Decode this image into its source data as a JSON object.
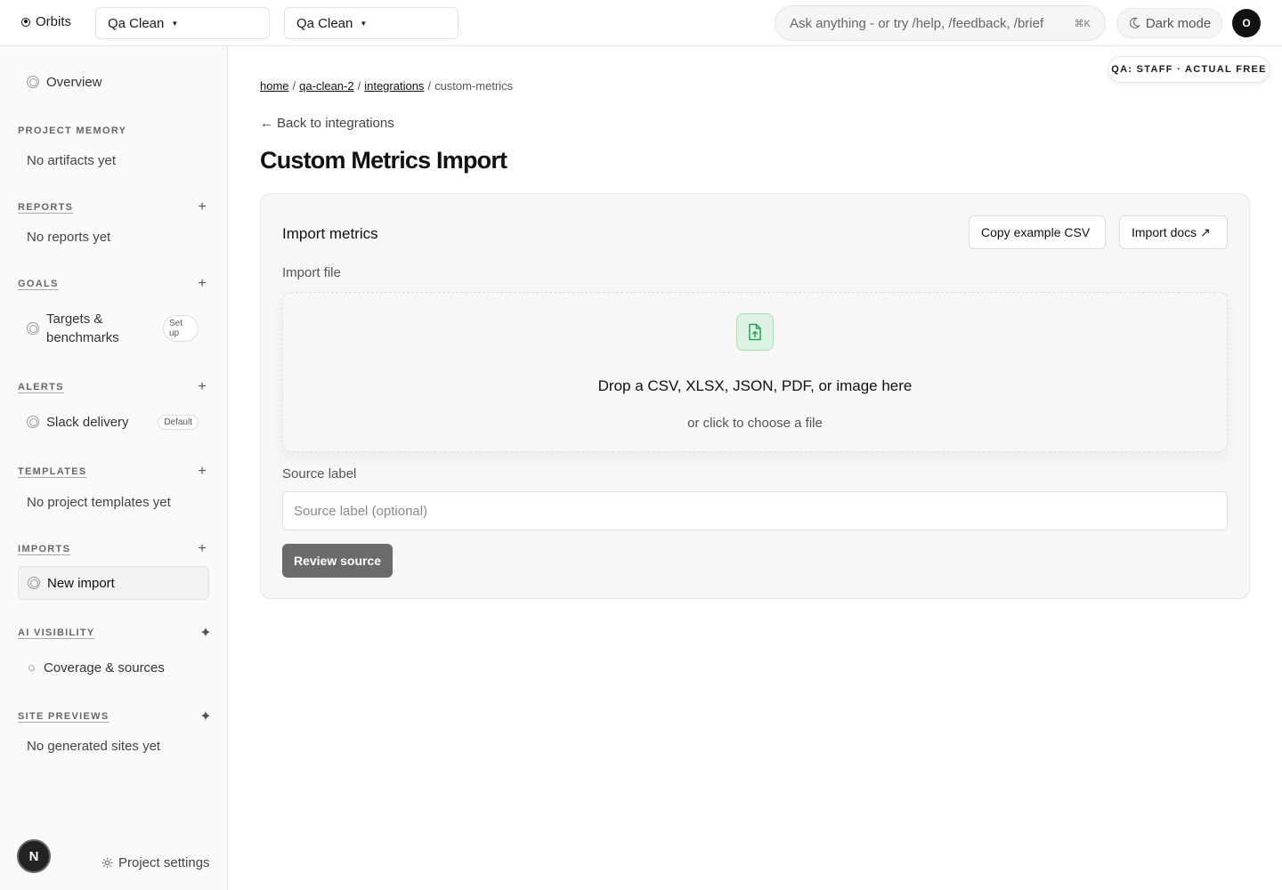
{
  "topbar": {
    "brand": "Orbits",
    "workspace_select": "Qa Clean",
    "project_select": "Qa Clean",
    "command_placeholder": "Ask anything - or try /help, /feedback, /brief",
    "command_shortcut": "⌘K",
    "dark_mode_label": "Dark mode",
    "avatar_initial": "O"
  },
  "sidebar": {
    "overview": "Overview",
    "sections": {
      "project_memory": {
        "label": "PROJECT MEMORY",
        "empty": "No artifacts yet"
      },
      "reports": {
        "label": "REPORTS",
        "empty": "No reports yet"
      },
      "goals": {
        "label": "GOALS",
        "item": "Targets & benchmarks",
        "badge": "Set up"
      },
      "alerts": {
        "label": "ALERTS",
        "item": "Slack delivery",
        "badge": "Default"
      },
      "templates": {
        "label": "TEMPLATES",
        "empty": "No project templates yet"
      },
      "imports": {
        "label": "IMPORTS",
        "item": "New import"
      },
      "ai_visibility": {
        "label": "AI VISIBILITY",
        "item": "Coverage & sources"
      },
      "site_previews": {
        "label": "SITE PREVIEWS",
        "empty": "No generated sites yet"
      }
    },
    "bottom_badge": "N",
    "project_settings": "Project settings"
  },
  "qa_badge": "QA: STAFF · ACTUAL FREE",
  "breadcrumb": {
    "home": "home",
    "project": "qa-clean-2",
    "integrations": "integrations",
    "current": "custom-metrics",
    "separator": "/"
  },
  "back_link": "Back to integrations",
  "page_title": "Custom Metrics Import",
  "card": {
    "title": "Import metrics",
    "copy_button": "Copy example CSV",
    "docs_button": "Import docs ↗",
    "import_file_label": "Import file",
    "drop_title": "Drop a CSV, XLSX, JSON, PDF, or image here",
    "drop_subtitle": "or click to choose a file",
    "source_label": "Source label",
    "source_placeholder": "Source label (optional)",
    "review_button": "Review source"
  },
  "colors": {
    "accent_green": "#22a55a",
    "review_button_bg": "#6b6b6b"
  }
}
